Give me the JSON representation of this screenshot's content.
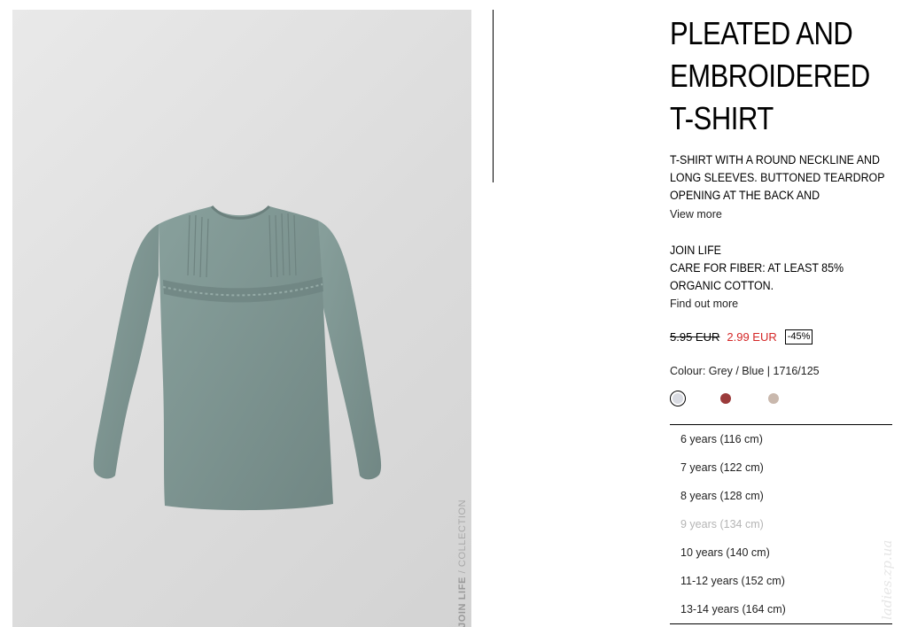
{
  "product": {
    "title_lines": [
      "PLEATED AND",
      "EMBROIDERED",
      "T-SHIRT"
    ],
    "description_lines": [
      "T-SHIRT WITH A ROUND NECKLINE AND",
      "LONG SLEEVES. BUTTONED TEARDROP",
      "OPENING AT THE BACK AND"
    ],
    "view_more": "View more",
    "join_life_lines": [
      "JOIN LIFE",
      "CARE FOR FIBER: AT LEAST 85%",
      "ORGANIC COTTON."
    ],
    "find_out_more": "Find out more",
    "old_price": "5.95 EUR",
    "new_price": "2.99 EUR",
    "discount": "-45%",
    "colour_label": "Colour: Grey / Blue | 1716/125"
  },
  "image": {
    "side_text_bold": "JOIN LIFE",
    "side_text_rest": " / COLLECTION"
  },
  "swatches": [
    {
      "name": "Grey / Blue",
      "color": "#d9dbe2",
      "selected": true
    },
    {
      "name": "Burgundy",
      "color": "#9b3b3b",
      "selected": false
    },
    {
      "name": "Beige",
      "color": "#c9b8ad",
      "selected": false
    }
  ],
  "sizes": [
    {
      "label": "6 years (116 cm)",
      "available": true
    },
    {
      "label": "7 years (122 cm)",
      "available": true
    },
    {
      "label": "8 years (128 cm)",
      "available": true
    },
    {
      "label": "9 years (134 cm)",
      "available": false
    },
    {
      "label": "10 years (140 cm)",
      "available": true
    },
    {
      "label": "11-12 years (152 cm)",
      "available": true
    },
    {
      "label": "13-14 years (164 cm)",
      "available": true
    }
  ],
  "watermark": "ladies.zp.ua",
  "colors": {
    "sale_price": "#d42626",
    "shirt": "#7f9592",
    "background": "#ffffff"
  }
}
